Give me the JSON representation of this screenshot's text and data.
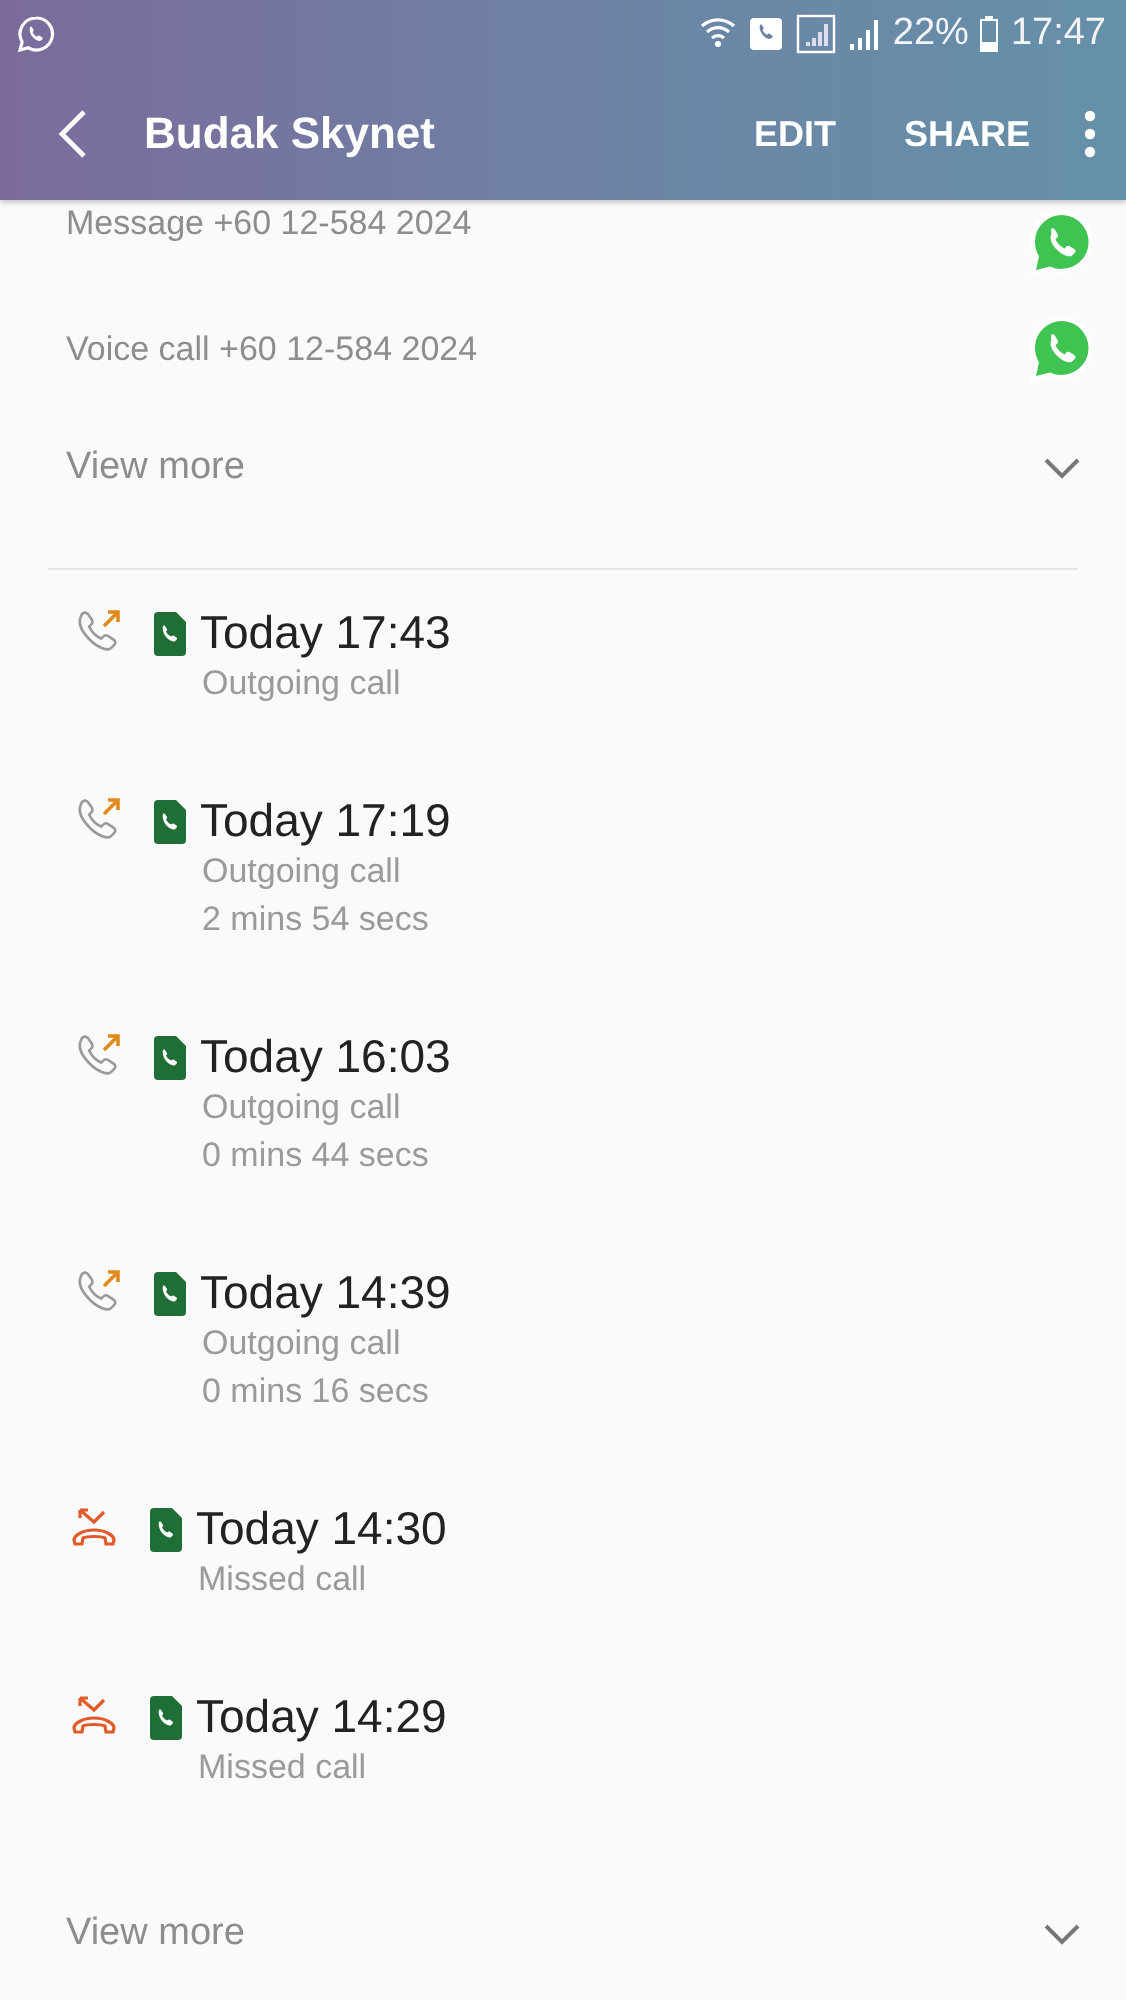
{
  "status_bar": {
    "battery": "22%",
    "time": "17:47"
  },
  "header": {
    "title": "Budak Skynet",
    "actions": [
      "EDIT",
      "SHARE"
    ]
  },
  "contact_actions": [
    {
      "label": "Message +60 12-584 2024"
    },
    {
      "label": "Voice call +60 12-584 2024"
    }
  ],
  "view_more_top": "View more",
  "calls": [
    {
      "kind": "outgoing",
      "time": "Today 17:43",
      "type": "Outgoing call"
    },
    {
      "kind": "outgoing",
      "time": "Today 17:19",
      "type": "Outgoing call",
      "duration": "2 mins 54 secs"
    },
    {
      "kind": "outgoing",
      "time": "Today 16:03",
      "type": "Outgoing call",
      "duration": "0 mins 44 secs"
    },
    {
      "kind": "outgoing",
      "time": "Today 14:39",
      "type": "Outgoing call",
      "duration": "0 mins 16 secs"
    },
    {
      "kind": "missed",
      "time": "Today 14:30",
      "type": "Missed call"
    },
    {
      "kind": "missed",
      "time": "Today 14:29",
      "type": "Missed call"
    }
  ],
  "view_more_bottom": "View more"
}
